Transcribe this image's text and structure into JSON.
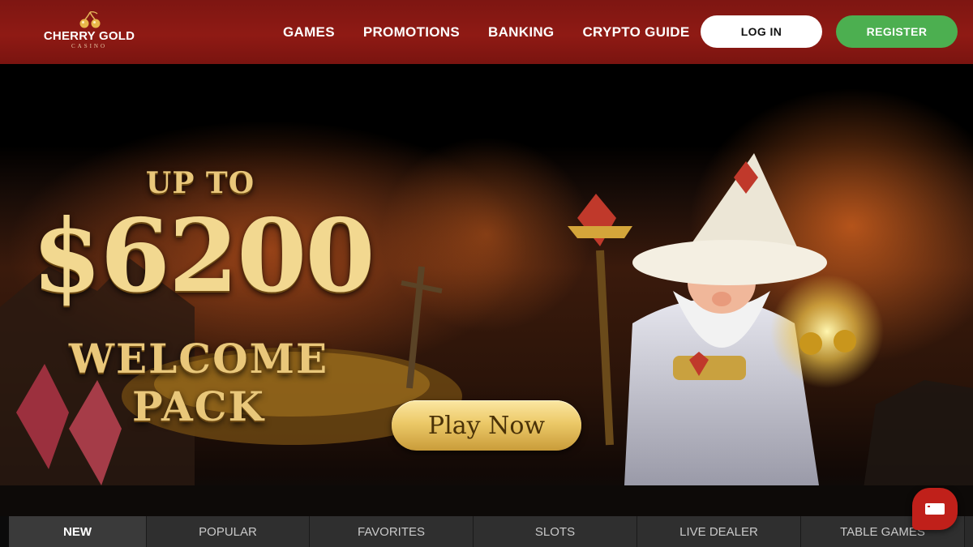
{
  "header": {
    "logo": {
      "name": "CHERRY GOLD",
      "sub": "CASINO"
    },
    "nav": [
      "GAMES",
      "PROMOTIONS",
      "BANKING",
      "CRYPTO GUIDE"
    ],
    "login_label": "LOG IN",
    "register_label": "REGISTER"
  },
  "hero": {
    "line1": "UP TO",
    "line2": "$6200",
    "line3": "WELCOME PACK",
    "cta_label": "Play Now"
  },
  "tabs": [
    {
      "label": "NEW",
      "active": true
    },
    {
      "label": "POPULAR",
      "active": false
    },
    {
      "label": "FAVORITES",
      "active": false
    },
    {
      "label": "SLOTS",
      "active": false
    },
    {
      "label": "LIVE DEALER",
      "active": false
    },
    {
      "label": "TABLE GAMES",
      "active": false
    }
  ],
  "colors": {
    "header_red": "#8f1a14",
    "register_green": "#4caf50",
    "gold_text": "#e9c77a",
    "chat_red": "#c0201a"
  },
  "icons": [
    "cherry-logo-icon",
    "chat-icon"
  ]
}
